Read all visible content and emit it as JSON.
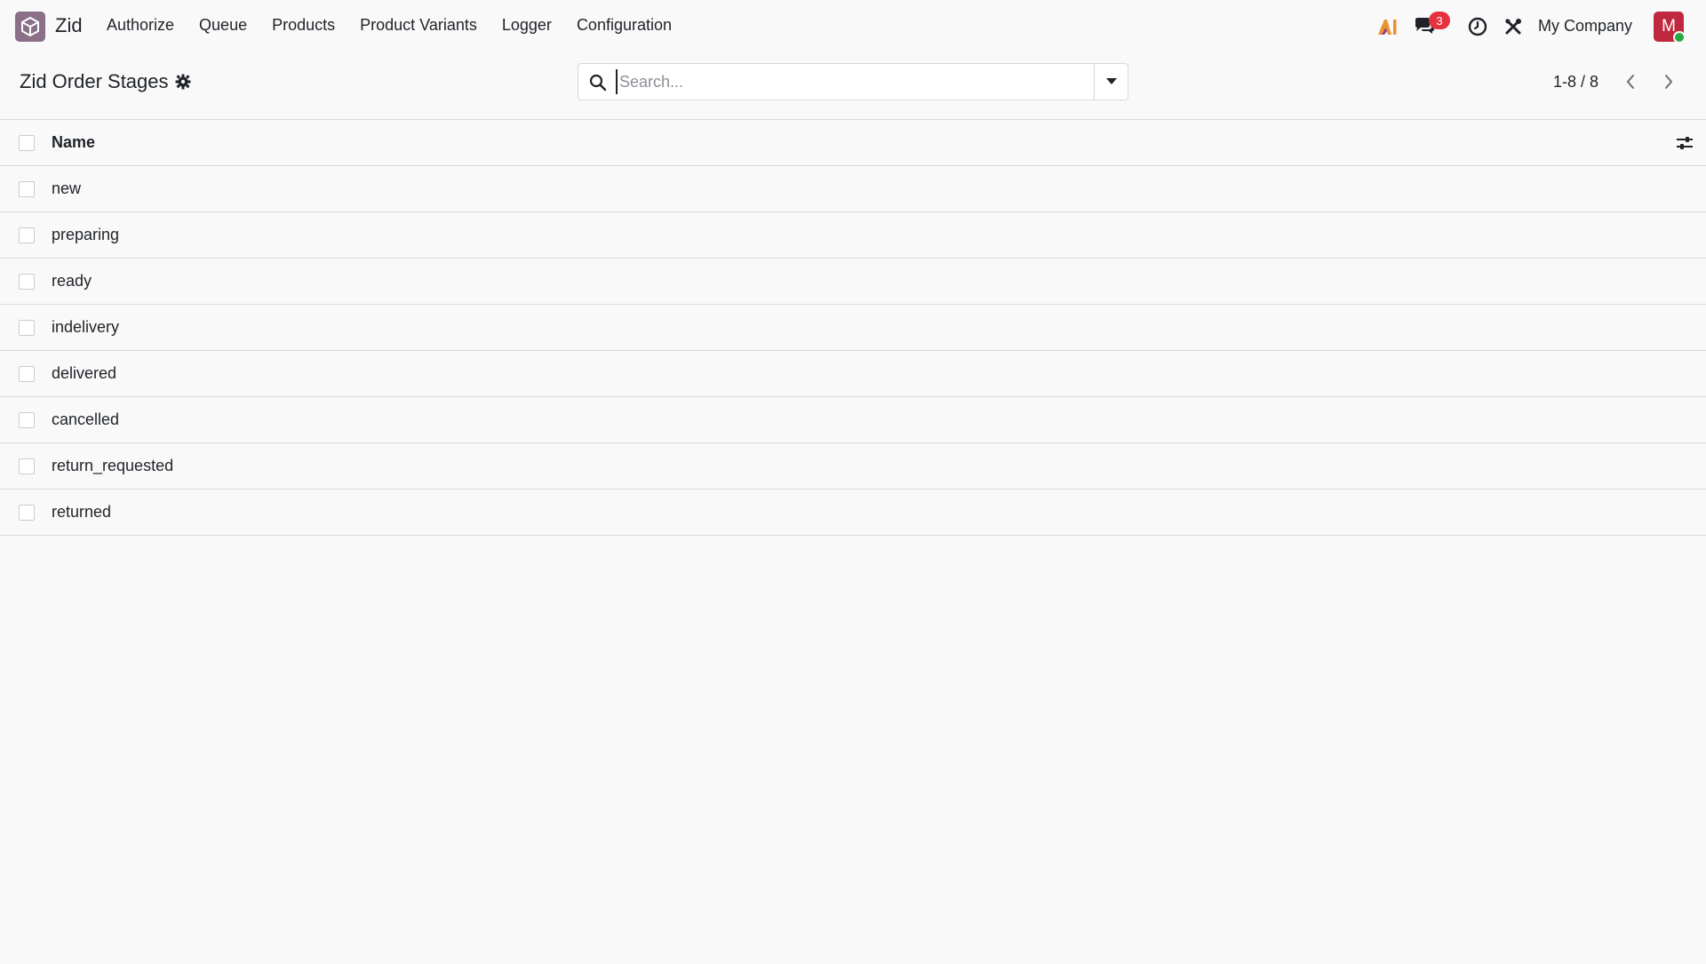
{
  "navbar": {
    "app_name": "Zid",
    "menu": [
      "Authorize",
      "Queue",
      "Products",
      "Product Variants",
      "Logger",
      "Configuration"
    ],
    "messages_badge": "3",
    "company": "My Company",
    "avatar_initial": "M",
    "colors": {
      "avatar": "#c0283f",
      "badge": "#e5323f",
      "status": "#28a745",
      "app_logo": "#8a6f86"
    }
  },
  "control_panel": {
    "title": "Zid Order Stages",
    "search_placeholder": "Search...",
    "pager": "1-8 / 8"
  },
  "list": {
    "columns": [
      "Name"
    ],
    "rows": [
      "new",
      "preparing",
      "ready",
      "indelivery",
      "delivered",
      "cancelled",
      "return_requested",
      "returned"
    ]
  }
}
